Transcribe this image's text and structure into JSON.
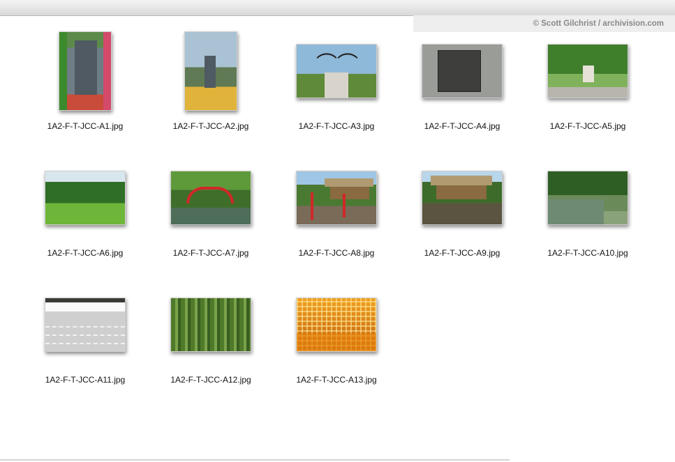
{
  "credit": "© Scott Gilchrist / archivision.com",
  "files": [
    {
      "name": "1A2-F-T-JCC-A1.jpg",
      "orientation": "portrait",
      "image": "memorial-stele-garden"
    },
    {
      "name": "1A2-F-T-JCC-A2.jpg",
      "orientation": "portrait",
      "image": "glass-building-statue"
    },
    {
      "name": "1A2-F-T-JCC-A3.jpg",
      "orientation": "landscape",
      "image": "eagle-sculpture"
    },
    {
      "name": "1A2-F-T-JCC-A4.jpg",
      "orientation": "landscape",
      "image": "stone-plaque"
    },
    {
      "name": "1A2-F-T-JCC-A5.jpg",
      "orientation": "landscape",
      "image": "garden-fountain"
    },
    {
      "name": "1A2-F-T-JCC-A6.jpg",
      "orientation": "landscape",
      "image": "lawn-trees"
    },
    {
      "name": "1A2-F-T-JCC-A7.jpg",
      "orientation": "landscape",
      "image": "red-bridge"
    },
    {
      "name": "1A2-F-T-JCC-A8.jpg",
      "orientation": "landscape",
      "image": "teahouse-bridge"
    },
    {
      "name": "1A2-F-T-JCC-A9.jpg",
      "orientation": "landscape",
      "image": "teahouse-pond"
    },
    {
      "name": "1A2-F-T-JCC-A10.jpg",
      "orientation": "landscape",
      "image": "pond-garden"
    },
    {
      "name": "1A2-F-T-JCC-A11.jpg",
      "orientation": "landscape",
      "image": "zen-gravel-garden"
    },
    {
      "name": "1A2-F-T-JCC-A12.jpg",
      "orientation": "landscape",
      "image": "bamboo-grove"
    },
    {
      "name": "1A2-F-T-JCC-A13.jpg",
      "orientation": "landscape",
      "image": "lattice-ceiling"
    }
  ]
}
